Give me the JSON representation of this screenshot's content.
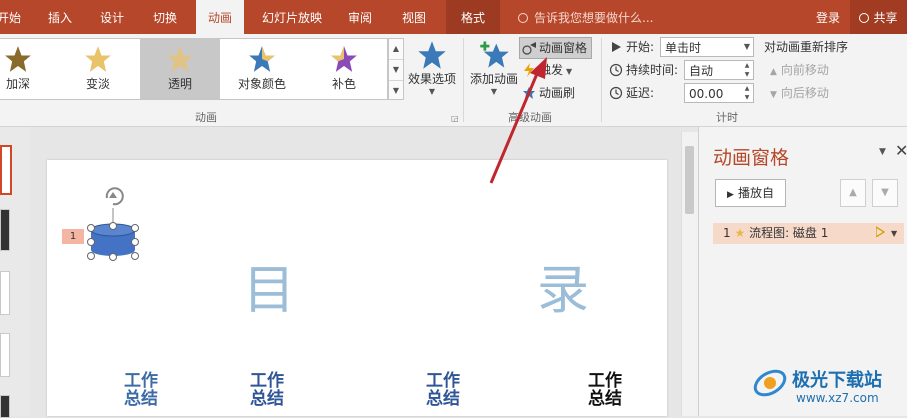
{
  "tabs": [
    {
      "label": "开始"
    },
    {
      "label": "插入"
    },
    {
      "label": "设计"
    },
    {
      "label": "切换"
    },
    {
      "label": "动画",
      "active": true
    },
    {
      "label": "幻灯片放映"
    },
    {
      "label": "审阅"
    },
    {
      "label": "视图"
    },
    {
      "label": "格式"
    }
  ],
  "tell_me": "告诉我您想要做什么...",
  "login": "登录",
  "share": "共享",
  "gallery": {
    "items": [
      {
        "label": "加深",
        "star_color": "#8a6a2a"
      },
      {
        "label": "变淡",
        "star_color": "#e8c36a"
      },
      {
        "label": "透明",
        "star_color": "#e6c27a"
      },
      {
        "label": "对象颜色",
        "star_color": "#3a7ab8"
      },
      {
        "label": "补色",
        "star_color": "#8a4ab8"
      }
    ],
    "selected_index": 2
  },
  "effect_options": "效果选项",
  "group_animation": "动画",
  "add_animation": "添加动画",
  "advanced": {
    "pane": "动画窗格",
    "trigger": "触发",
    "painter": "动画刷",
    "group_label": "高级动画"
  },
  "timing": {
    "start_label": "开始:",
    "start_value": "单击时",
    "duration_label": "持续时间:",
    "duration_value": "自动",
    "delay_label": "延迟:",
    "delay_value": "00.00",
    "group_label": "计时"
  },
  "reorder": {
    "title": "对动画重新排序",
    "earlier": "向前移动",
    "later": "向后移动"
  },
  "slide": {
    "anim_number": "1",
    "title_chars": [
      "目",
      "录"
    ],
    "items": [
      "工作总结",
      "工作总结",
      "工作总结",
      "工作总结"
    ]
  },
  "pane": {
    "title": "动画窗格",
    "play": "播放自",
    "item_number": "1",
    "item_label": "流程图: 磁盘 1"
  },
  "watermark": {
    "cn": "极光下载站",
    "url": "www.xz7.com"
  },
  "colors": {
    "accent": "#b7472a",
    "shape_blue": "#4472c4"
  }
}
